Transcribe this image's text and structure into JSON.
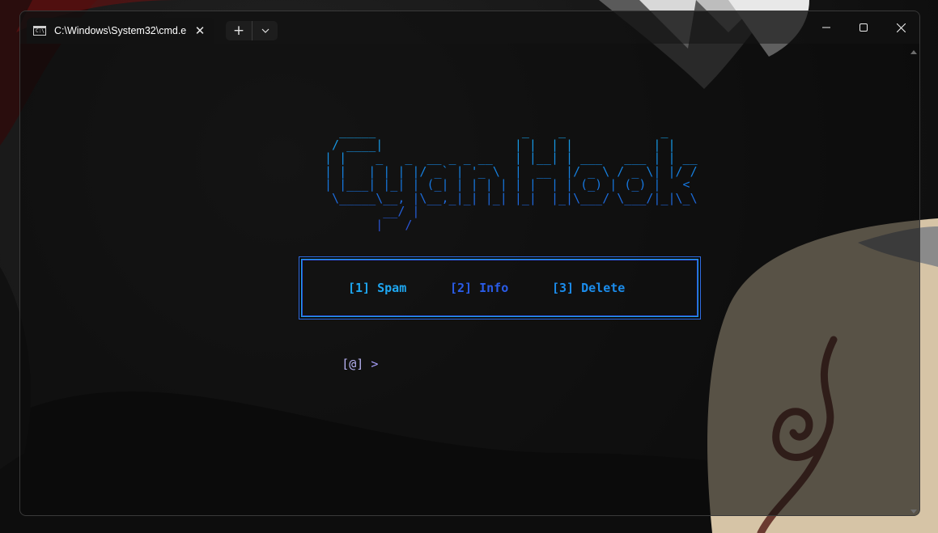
{
  "window": {
    "tab_title": "C:\\Windows\\System32\\cmd.e",
    "tab_icon_text": "C:\\",
    "tab_close_glyph": "✕",
    "new_tab_glyph": "+",
    "dropdown_glyph": "⌵"
  },
  "terminal": {
    "ascii_art": "   _____                    _    _             _    \n  / ____|                  | |  | |           | |   \n | |    _   _  __ _ _ __   | |__| | ___   ___ | | __\n | |   | | | |/ _` | '_ \\  |  __  |/ _ \\ / _ \\| |/ /\n | |___| |_| | (_| | | | | | |  | | (_) | (_) |   < \n  \\_____\\__, |\\__,_|_| |_| |_|  |_|\\___/ \\___/|_|\\_\\\n         __/ |                                     \n        |___/                                      ",
    "menu": [
      {
        "label": "[1] Spam",
        "color": "#1ea6f0"
      },
      {
        "label": "[2] Info",
        "color": "#2a5ce8"
      },
      {
        "label": "[3] Delete",
        "color": "#1b8ceb"
      }
    ],
    "prompt_prefix": "[@]",
    "prompt_arrow": ">",
    "prompt_prefix_color": "#b6b2f2",
    "prompt_arrow_color": "#a39bf5"
  },
  "colors": {
    "gradient_top": "#17a8e6",
    "gradient_bottom": "#2d4fd4",
    "box_outer": "#2f6be0",
    "box_inner": "#1fa0e8"
  }
}
